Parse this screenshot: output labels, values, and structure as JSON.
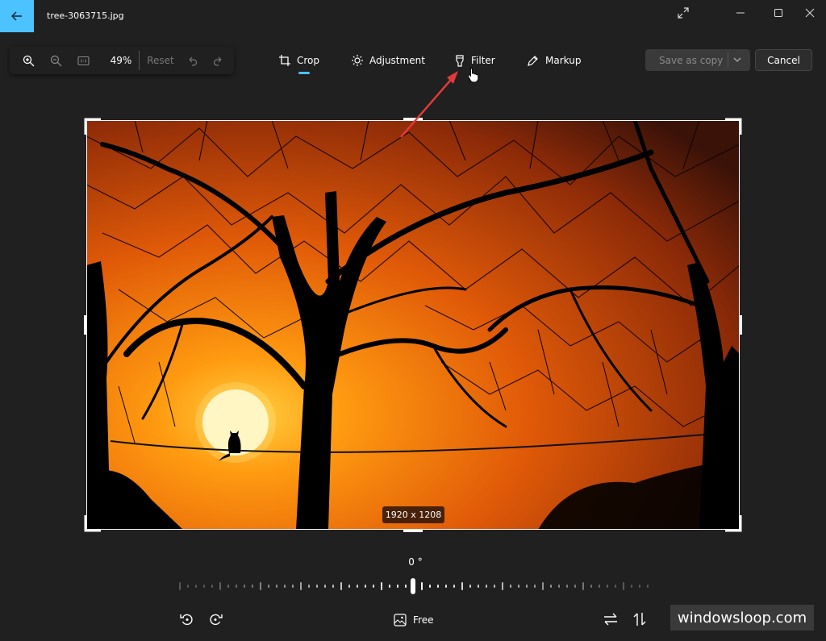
{
  "window": {
    "title": "tree-3063715.jpg"
  },
  "zoom_bar": {
    "zoom_level": "49%",
    "reset_label": "Reset"
  },
  "tabs": [
    {
      "label": "Crop",
      "icon": "crop-icon",
      "active": true
    },
    {
      "label": "Adjustment",
      "icon": "brightness-icon",
      "active": false
    },
    {
      "label": "Filter",
      "icon": "filter-icon",
      "active": false
    },
    {
      "label": "Markup",
      "icon": "pen-icon",
      "active": false
    }
  ],
  "actions": {
    "save_label": "Save as copy",
    "cancel_label": "Cancel"
  },
  "crop": {
    "dimensions": "1920 x 1208",
    "angle": "0 °",
    "aspect_label": "Free"
  },
  "watermark": "windowsloop.com",
  "colors": {
    "accent": "#4cc2ff",
    "background": "#202020",
    "annotation_arrow": "#e03a3a"
  }
}
